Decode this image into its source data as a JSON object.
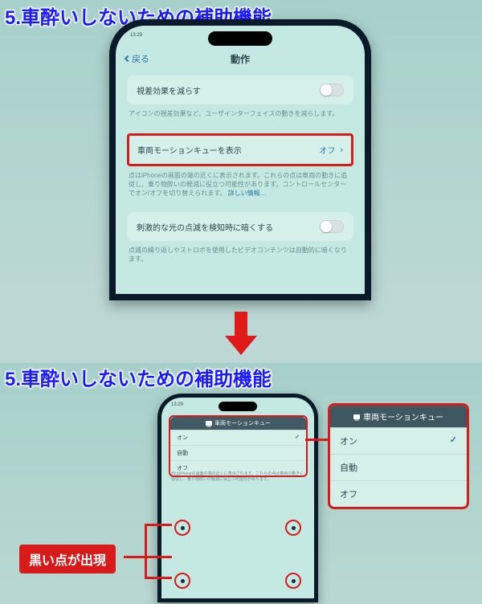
{
  "titles": {
    "section": "5.車酔いしないための補助機能"
  },
  "topScreen": {
    "back": "戻る",
    "navTitle": "動作",
    "row1": {
      "label": "視差効果を減らす"
    },
    "row1_desc": "アイコンの視差効果など、ユーザインターフェイスの動きを減らします。",
    "row2": {
      "label": "車両モーションキューを表示",
      "value": "オフ"
    },
    "row2_desc": "点はiPhoneの画面の端の近くに表示されます。これらの点は車両の動きに追従し、乗り物酔いの軽減に役立つ可能性があります。コントロールセンターでオン/オフを切り替えられます。",
    "row2_desc_link": "詳しい情報…",
    "row3": {
      "label": "刺激的な光の点滅を検知時に暗くする"
    },
    "row3_desc": "点滅の繰り返しやストロボを使用したビデオコンテンツは自動的に暗くなります。",
    "clock": "13:29"
  },
  "botScreen": {
    "clock": "13:29",
    "menuTitle": "車両モーションキュー",
    "options": {
      "on": "オン",
      "auto": "自動",
      "off": "オフ"
    },
    "desc": "点はiPhoneの画面の端の近くに表示されます。これらの点は車両の動きに追従し、乗り物酔いの軽減に役立つ可能性があります。"
  },
  "callout": "黒い点が出現"
}
